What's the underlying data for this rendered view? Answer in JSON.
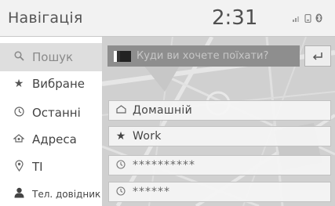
{
  "header": {
    "title": "Навігація",
    "clock": "2:31",
    "status_icons": [
      "signal-icon",
      "phone-icon",
      "bluetooth-icon"
    ]
  },
  "sidebar": {
    "items": [
      {
        "label": "Пошук",
        "icon": "search-icon",
        "active": true
      },
      {
        "label": "Вибране",
        "icon": "star-icon",
        "active": false
      },
      {
        "label": "Останні",
        "icon": "clock-icon",
        "active": false
      },
      {
        "label": "Адреса",
        "icon": "address-icon",
        "active": false
      },
      {
        "label": "TI",
        "icon": "pin-icon",
        "active": false
      },
      {
        "label": "Тел. довідник",
        "icon": "person-icon",
        "active": false
      }
    ]
  },
  "search": {
    "placeholder": "Куди ви хочете поїхати?"
  },
  "destinations": [
    {
      "label": "Домашній",
      "icon": "home-icon"
    },
    {
      "label": "Work",
      "icon": "star-icon"
    },
    {
      "label": "**********",
      "icon": "clock-icon"
    },
    {
      "label": "******",
      "icon": "clock-icon"
    }
  ],
  "colors": {
    "sidebar_active": "#dedede",
    "search_bar": "#8e8e8e",
    "map_bg": "#cfcfcf"
  }
}
